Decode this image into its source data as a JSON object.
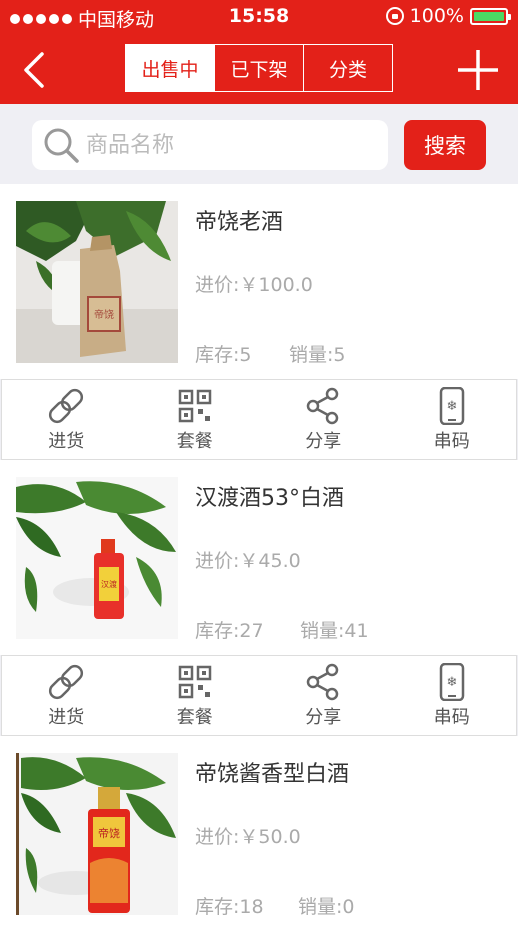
{
  "status_bar": {
    "carrier": "中国移动",
    "time": "15:58",
    "battery": "100%"
  },
  "nav": {
    "tabs": [
      "出售中",
      "已下架",
      "分类"
    ],
    "active_tab": 0
  },
  "search": {
    "placeholder": "商品名称",
    "button": "搜索"
  },
  "products": [
    {
      "name": "帝饶老酒",
      "price": "进价:￥100.0",
      "stock": "库存:5",
      "sales": "销量:5"
    },
    {
      "name": "汉渡酒53°白酒",
      "price": "进价:￥45.0",
      "stock": "库存:27",
      "sales": "销量:41"
    },
    {
      "name": "帝饶酱香型白酒",
      "price": "进价:￥50.0",
      "stock": "库存:18",
      "sales": "销量:0"
    }
  ],
  "actions": [
    "进货",
    "套餐",
    "分享",
    "串码"
  ],
  "colors": {
    "accent": "#e32119",
    "battery": "#4cd964"
  }
}
